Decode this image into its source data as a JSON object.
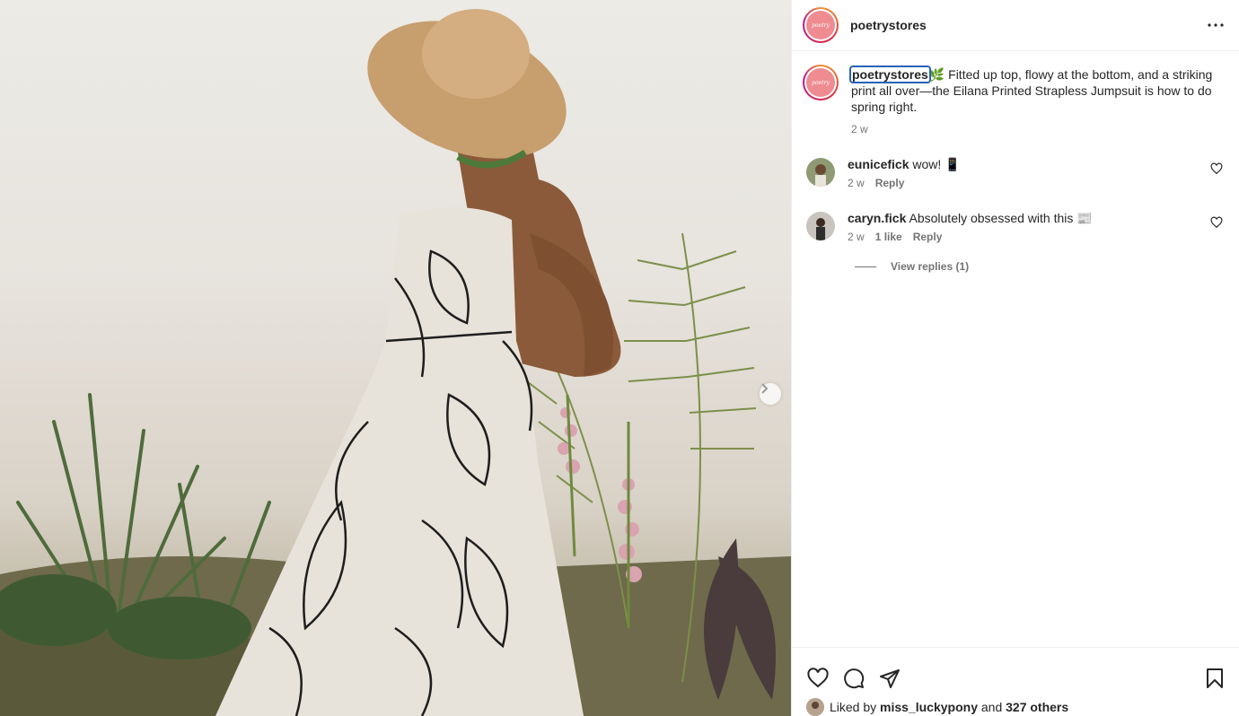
{
  "post": {
    "username": "poetrystores",
    "avatar_text": "poetry",
    "more_icon": "ellipsis-icon",
    "caption_emoji": "🌿",
    "caption_text": " Fitted up top, flowy at the bottom, and a striking print all over—the Eilana Printed Strapless Jumpsuit is how to do spring right.",
    "caption_time": "2 w"
  },
  "comments": [
    {
      "username": "eunicefick",
      "text": "wow! ",
      "emoji": "📱",
      "time": "2 w",
      "likes": "",
      "reply_label": "Reply"
    },
    {
      "username": "caryn.fick",
      "text": "Absolutely obsessed with this ",
      "emoji": "📰",
      "time": "2 w",
      "likes": "1 like",
      "reply_label": "Reply",
      "view_replies": "View replies (1)"
    }
  ],
  "footer": {
    "liked_by_prefix": "Liked by ",
    "liked_by_user": "miss_luckypony",
    "liked_by_joiner": " and ",
    "liked_by_others": "327 others",
    "icons": [
      "heart-icon",
      "comment-icon",
      "share-icon",
      "bookmark-icon"
    ]
  },
  "colors": {
    "text": "#262626",
    "muted": "#737373",
    "brand_avatar": "#ee8c91",
    "focus_outline": "#2563b8"
  }
}
